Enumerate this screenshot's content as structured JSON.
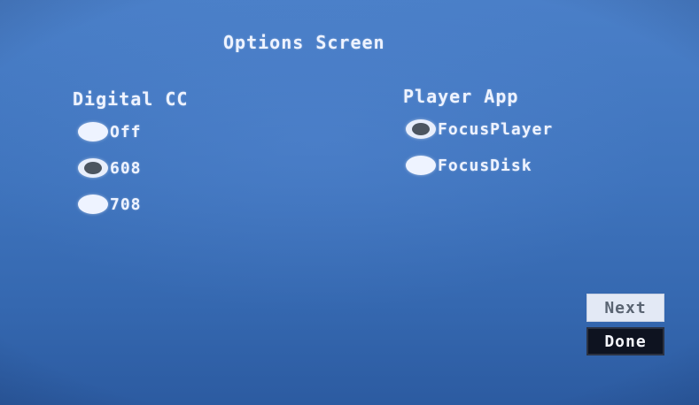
{
  "screen": {
    "title": "Options Screen"
  },
  "digital_cc": {
    "label": "Digital CC",
    "options": [
      {
        "label": "Off",
        "selected": false
      },
      {
        "label": "608",
        "selected": true
      },
      {
        "label": "708",
        "selected": false
      }
    ]
  },
  "player_app": {
    "label": "Player App",
    "options": [
      {
        "label": "FocusPlayer",
        "selected": true
      },
      {
        "label": "FocusDisk",
        "selected": false
      }
    ]
  },
  "buttons": {
    "next": "Next",
    "done": "Done"
  },
  "colors": {
    "background": "#3f74bd",
    "text": "#eef3ff",
    "radio_fill": "#eef3ff",
    "radio_selected_dot": "#4c5560",
    "next_button_bg": "#e3e9f5",
    "done_button_bg": "#0e1320"
  }
}
